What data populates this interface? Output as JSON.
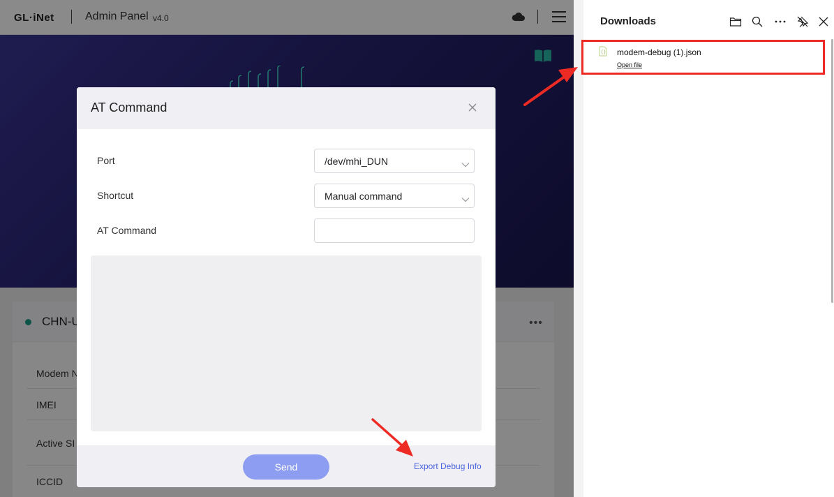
{
  "header": {
    "logo": "GL·iNet",
    "panel_title": "Admin Panel",
    "version": "v4.0"
  },
  "modem_card": {
    "title": "CHN-U",
    "rows": [
      "Modem N",
      "IMEI",
      "Active SI",
      "ICCID"
    ]
  },
  "at_dialog": {
    "title": "AT Command",
    "port_label": "Port",
    "port_value": "/dev/mhi_DUN",
    "shortcut_label": "Shortcut",
    "shortcut_value": "Manual command",
    "command_label": "AT Command",
    "command_value": "",
    "send_label": "Send",
    "export_label": "Export Debug Info"
  },
  "downloads": {
    "title": "Downloads",
    "items": [
      {
        "file_name": "modem-debug (1).json",
        "action": "Open file"
      }
    ]
  },
  "icons": {
    "cloud": "cloud-icon",
    "menu": "hamburger-menu-icon",
    "book": "book-icon",
    "close": "close-icon",
    "folder": "folder-icon",
    "search": "search-icon",
    "more": "more-icon",
    "pin": "pin-off-icon",
    "file": "json-file-icon"
  },
  "colors": {
    "accent": "#4a63e0",
    "send_button": "#8d9df2",
    "highlight": "#ee2a24",
    "hero": "#27226f",
    "status_dot": "#1b9a86"
  }
}
